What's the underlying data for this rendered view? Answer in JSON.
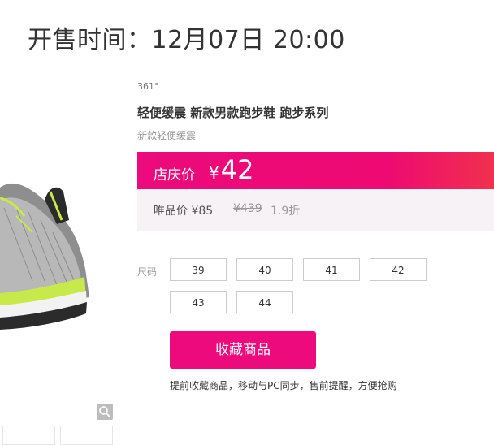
{
  "header": {
    "sale_time": "开售时间：12月07日 20:00"
  },
  "product": {
    "brand": "361°",
    "title": "轻便缓震 新款男款跑步鞋 跑步系列",
    "subtitle": "新款轻便缓震"
  },
  "price": {
    "promo_label": "店庆价",
    "currency": "¥",
    "promo_value": "42",
    "vip_label": "唯品价 ¥85",
    "original": "¥439",
    "discount": "1.9折"
  },
  "sizes": {
    "label": "尺码",
    "options": [
      "39",
      "40",
      "41",
      "42",
      "43",
      "44"
    ]
  },
  "actions": {
    "favorite_label": "收藏商品",
    "favorite_note": "提前收藏商品，移动与PC同步，售前提醒，方便抢购"
  },
  "icons": {
    "zoom": "magnifier-icon"
  },
  "colors": {
    "accent": "#ec0a7c",
    "shoe_accent": "#c7e94a"
  }
}
